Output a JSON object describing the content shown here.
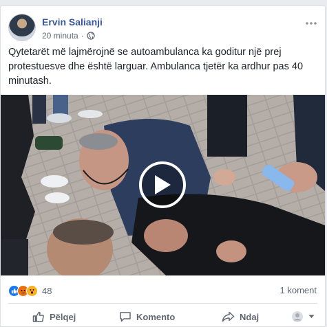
{
  "post": {
    "author": "Ervin Salianji",
    "time": "20 minuta",
    "separator": "·",
    "text": "Qytetarët më lajmërojnë se autoambulanca ka goditur një prej protestuesve dhe është larguar. Ambulanca tjetër ka ardhur pas 40 minutash."
  },
  "stats": {
    "reactions_count": "48",
    "reaction_icons": [
      "like-icon",
      "angry-icon",
      "wow-icon"
    ],
    "comments": "1 koment"
  },
  "actions": {
    "like": "Pëlqej",
    "comment": "Komento",
    "share": "Ndaj"
  },
  "colors": {
    "name": "#385898",
    "like_blue": "#1877f2",
    "angry": "#e9710f",
    "wow": "#f7b125"
  }
}
